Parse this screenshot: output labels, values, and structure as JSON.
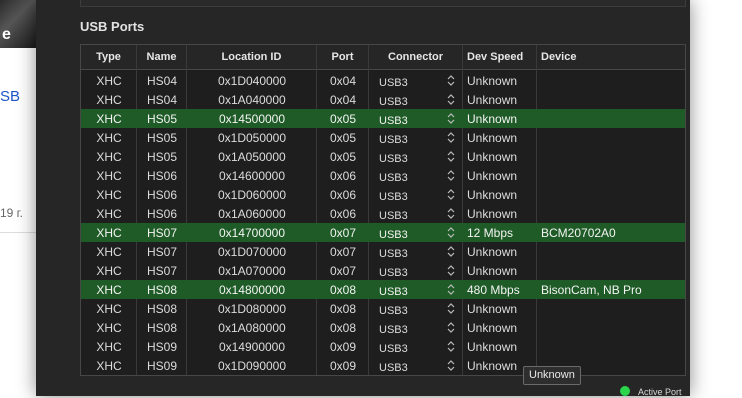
{
  "background_page": {
    "thumb_text": "e",
    "link_text": "SB",
    "date_text": "19 г."
  },
  "section": {
    "title": "USB Ports"
  },
  "table": {
    "columns": [
      "Type",
      "Name",
      "Location ID",
      "Port",
      "Connector",
      "Dev Speed",
      "Device"
    ],
    "rows": [
      {
        "type": "XHC",
        "name": "HS04",
        "location": "0x1D040000",
        "port": "0x04",
        "connector": "USB3",
        "speed": "Unknown",
        "device": "",
        "active": false
      },
      {
        "type": "XHC",
        "name": "HS04",
        "location": "0x1A040000",
        "port": "0x04",
        "connector": "USB3",
        "speed": "Unknown",
        "device": "",
        "active": false
      },
      {
        "type": "XHC",
        "name": "HS05",
        "location": "0x14500000",
        "port": "0x05",
        "connector": "USB3",
        "speed": "Unknown",
        "device": "",
        "active": true
      },
      {
        "type": "XHC",
        "name": "HS05",
        "location": "0x1D050000",
        "port": "0x05",
        "connector": "USB3",
        "speed": "Unknown",
        "device": "",
        "active": false
      },
      {
        "type": "XHC",
        "name": "HS05",
        "location": "0x1A050000",
        "port": "0x05",
        "connector": "USB3",
        "speed": "Unknown",
        "device": "",
        "active": false
      },
      {
        "type": "XHC",
        "name": "HS06",
        "location": "0x14600000",
        "port": "0x06",
        "connector": "USB3",
        "speed": "Unknown",
        "device": "",
        "active": false
      },
      {
        "type": "XHC",
        "name": "HS06",
        "location": "0x1D060000",
        "port": "0x06",
        "connector": "USB3",
        "speed": "Unknown",
        "device": "",
        "active": false
      },
      {
        "type": "XHC",
        "name": "HS06",
        "location": "0x1A060000",
        "port": "0x06",
        "connector": "USB3",
        "speed": "Unknown",
        "device": "",
        "active": false
      },
      {
        "type": "XHC",
        "name": "HS07",
        "location": "0x14700000",
        "port": "0x07",
        "connector": "USB3",
        "speed": "12 Mbps",
        "device": "BCM20702A0",
        "active": true
      },
      {
        "type": "XHC",
        "name": "HS07",
        "location": "0x1D070000",
        "port": "0x07",
        "connector": "USB3",
        "speed": "Unknown",
        "device": "",
        "active": false
      },
      {
        "type": "XHC",
        "name": "HS07",
        "location": "0x1A070000",
        "port": "0x07",
        "connector": "USB3",
        "speed": "Unknown",
        "device": "",
        "active": false
      },
      {
        "type": "XHC",
        "name": "HS08",
        "location": "0x14800000",
        "port": "0x08",
        "connector": "USB3",
        "speed": "480 Mbps",
        "device": "BisonCam, NB Pro",
        "active": true
      },
      {
        "type": "XHC",
        "name": "HS08",
        "location": "0x1D080000",
        "port": "0x08",
        "connector": "USB3",
        "speed": "Unknown",
        "device": "",
        "active": false
      },
      {
        "type": "XHC",
        "name": "HS08",
        "location": "0x1A080000",
        "port": "0x08",
        "connector": "USB3",
        "speed": "Unknown",
        "device": "",
        "active": false
      },
      {
        "type": "XHC",
        "name": "HS09",
        "location": "0x14900000",
        "port": "0x09",
        "connector": "USB3",
        "speed": "Unknown",
        "device": "",
        "active": false
      },
      {
        "type": "XHC",
        "name": "HS09",
        "location": "0x1D090000",
        "port": "0x09",
        "connector": "USB3",
        "speed": "Unknown",
        "device": "",
        "active": false
      }
    ]
  },
  "tooltip": {
    "text": "Unknown"
  },
  "legend": {
    "label": "Active Port",
    "color": "#2bd54b"
  },
  "colors": {
    "active_row": "#1e5b26",
    "window_bg": "#262626"
  }
}
